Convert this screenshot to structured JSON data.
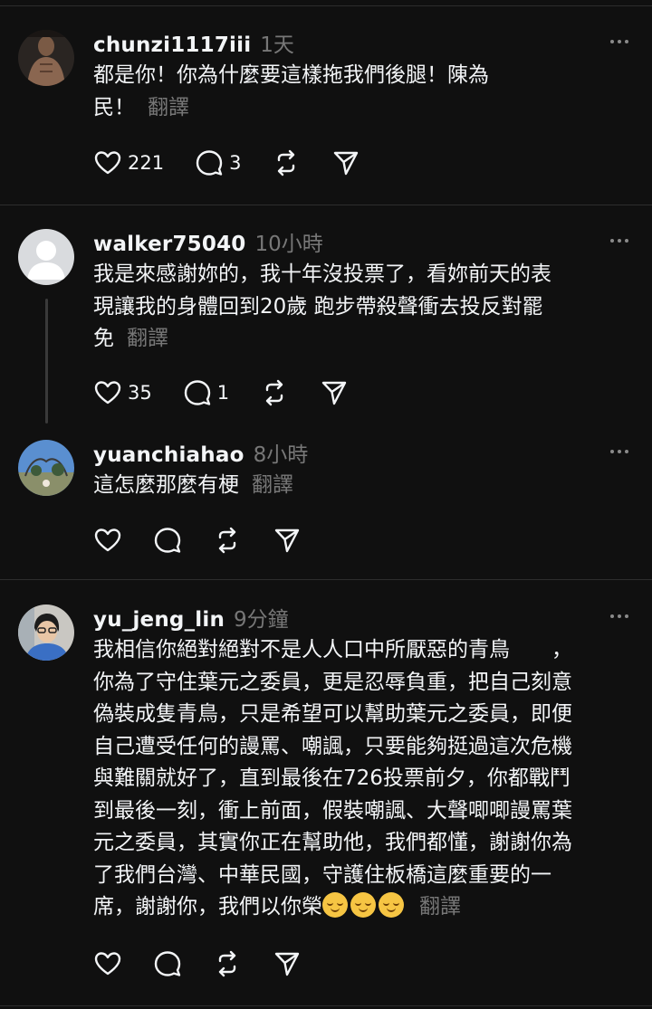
{
  "posts": [
    {
      "username": "chunzi1117iii",
      "time": "1天",
      "text": "都是你！你為什麼要這樣拖我們後腿！陳為\n民！",
      "translate": "翻譯",
      "likes": "221",
      "replies": "3"
    },
    {
      "username": "walker75040",
      "time": "10小時",
      "text": "我是來感謝妳的，我十年沒投票了，看妳前天的表\n現讓我的身體回到20歲 跑步帶殺聲衝去投反對罷\n免",
      "translate": "翻譯",
      "likes": "35",
      "replies": "1"
    },
    {
      "username": "yuanchiahao",
      "time": "8小時",
      "text": "這怎麼那麼有梗",
      "translate": "翻譯"
    },
    {
      "username": "yu_jeng_lin",
      "time": "9分鐘",
      "text": "我相信你絕對絕對不是人人口中所厭惡的青鳥　　，\n你為了守住葉元之委員，更是忍辱負重，把自己刻意\n偽裝成隻青鳥，只是希望可以幫助葉元之委員，即便\n自己遭受任何的謾罵、嘲諷，只要能夠挺過這次危機\n與難關就好了，直到最後在726投票前夕，你都戰鬥\n到最後一刻，衝上前面，假裝嘲諷、大聲唧唧謾罵葉\n元之委員，其實你正在幫助他，我們都懂，謝謝你為\n了我們台灣、中華民國，守護住板橋這麼重要的一\n席，謝謝你，我們以你榮",
      "translate": "翻譯"
    }
  ],
  "icons": {
    "like": "heart-icon",
    "reply": "comment-icon",
    "repost": "repost-icon",
    "share": "send-icon",
    "more": "more-icon"
  }
}
